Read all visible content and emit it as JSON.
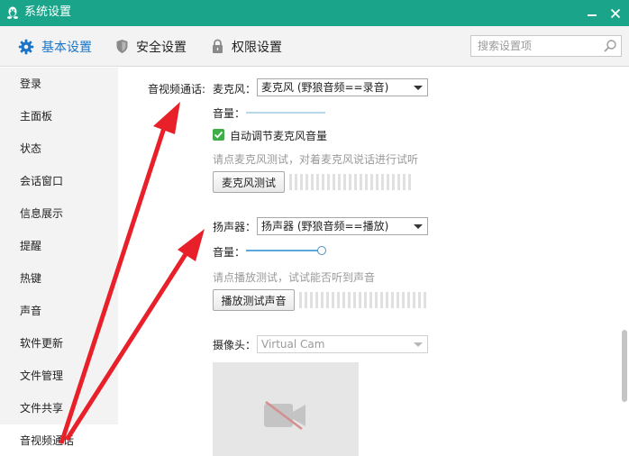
{
  "window": {
    "title": "系统设置"
  },
  "tabs": [
    {
      "label": "基本设置",
      "icon": "gear-icon",
      "active": true
    },
    {
      "label": "安全设置",
      "icon": "shield-icon"
    },
    {
      "label": "权限设置",
      "icon": "lock-icon"
    }
  ],
  "search": {
    "placeholder": "搜索设置项"
  },
  "sidebar": {
    "items": [
      "登录",
      "主面板",
      "状态",
      "会话窗口",
      "信息展示",
      "提醒",
      "热键",
      "声音",
      "软件更新",
      "文件管理",
      "文件共享",
      "音视频通话"
    ],
    "active_index": 11
  },
  "av": {
    "section_label": "音视频通话:",
    "mic": {
      "label": "麦克风：",
      "device": "麦克风 (野狼音频==录音)",
      "volume_label": "音量：",
      "auto_adjust_label": "自动调节麦克风音量",
      "auto_adjust_checked": true,
      "hint": "请点麦克风测试，对着麦克风说话进行试听",
      "test_button": "麦克风测试"
    },
    "speaker": {
      "label": "扬声器：",
      "device": "扬声器 (野狼音频==播放)",
      "volume_label": "音量：",
      "volume_fraction": 1.0,
      "hint": "请点播放测试，试试能否听到声音",
      "test_button": "播放测试声音"
    },
    "camera": {
      "label": "摄像头：",
      "device": "Virtual Cam"
    }
  },
  "colors": {
    "titlebar": "#1aa58b",
    "active_tab": "#1a74c8",
    "checkbox": "#3fae49",
    "arrow": "#e8202a"
  }
}
